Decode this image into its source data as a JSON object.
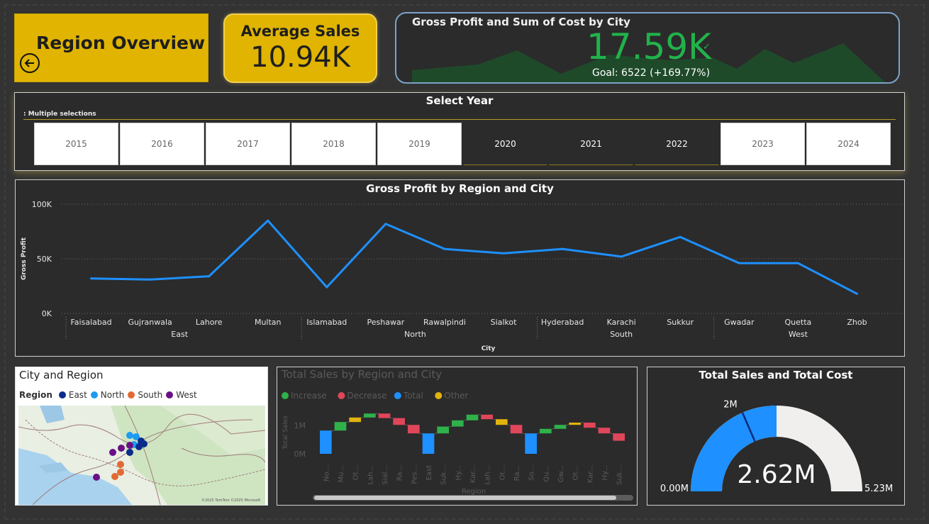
{
  "header": {
    "title": "Region Overview",
    "back_icon": "back-arrow-icon"
  },
  "average_sales": {
    "label": "Average Sales",
    "value": "10.94K"
  },
  "kpi": {
    "label": "Gross Profit and Sum of Cost by City",
    "value": "17.59K",
    "goal": "Goal: 6522 (+169.77%)",
    "trend_color": "#1f5a2e",
    "value_color": "#21b24b"
  },
  "year_slicer": {
    "title": "Select Year",
    "selection_label": ": Multiple selections",
    "years": [
      {
        "label": "2015",
        "selected": false
      },
      {
        "label": "2016",
        "selected": false
      },
      {
        "label": "2017",
        "selected": false
      },
      {
        "label": "2018",
        "selected": false
      },
      {
        "label": "2019",
        "selected": false
      },
      {
        "label": "2020",
        "selected": true
      },
      {
        "label": "2021",
        "selected": true
      },
      {
        "label": "2022",
        "selected": true
      },
      {
        "label": "2023",
        "selected": false
      },
      {
        "label": "2024",
        "selected": false
      }
    ]
  },
  "chart_data": [
    {
      "type": "line",
      "title": "Gross Profit by Region and City",
      "xlabel": "City",
      "ylabel": "Gross Profit",
      "ylim": [
        0,
        100000
      ],
      "yticks": [
        "0K",
        "50K",
        "100K"
      ],
      "grid": true,
      "color": "#1e90ff",
      "categories": [
        "Faisalabad",
        "Gujranwala",
        "Lahore",
        "Multan",
        "Islamabad",
        "Peshawar",
        "Rawalpindi",
        "Sialkot",
        "Hyderabad",
        "Karachi",
        "Sukkur",
        "Gwadar",
        "Quetta",
        "Zhob"
      ],
      "groups": [
        {
          "name": "East",
          "count": 4
        },
        {
          "name": "North",
          "count": 4
        },
        {
          "name": "South",
          "count": 3
        },
        {
          "name": "West",
          "count": 3
        }
      ],
      "values": [
        32000,
        31000,
        34000,
        85000,
        24000,
        82000,
        59000,
        55000,
        59000,
        52000,
        70000,
        46000,
        46000,
        18000
      ]
    },
    {
      "type": "bar",
      "subtype": "waterfall",
      "title": "Total Sales by Region and City",
      "xlabel": "Region",
      "ylabel": "Total Sales",
      "yticks": [
        "0M",
        "1M"
      ],
      "legend": [
        {
          "name": "Increase",
          "color": "#2fb24a"
        },
        {
          "name": "Decrease",
          "color": "#e0465a"
        },
        {
          "name": "Total",
          "color": "#1e90ff"
        },
        {
          "name": "Other",
          "color": "#e2b20e"
        }
      ],
      "categories": [
        "No...",
        "Mu...",
        "Ot...",
        "Lah...",
        "Sial...",
        "Ra...",
        "Pes...",
        "East",
        "Suk...",
        "Hy...",
        "Kar...",
        "Lah...",
        "Ot...",
        "Ra...",
        "So...",
        "Qu...",
        "Gw...",
        "Ot...",
        "Kar...",
        "Hy...",
        "Suk..."
      ],
      "bars": [
        {
          "kind": "Total",
          "from": 0.0,
          "to": 0.82
        },
        {
          "kind": "Increase",
          "from": 0.82,
          "to": 1.12
        },
        {
          "kind": "Other",
          "from": 1.12,
          "to": 1.28
        },
        {
          "kind": "Increase",
          "from": 1.28,
          "to": 1.42
        },
        {
          "kind": "Decrease",
          "from": 1.42,
          "to": 1.26
        },
        {
          "kind": "Decrease",
          "from": 1.26,
          "to": 1.02
        },
        {
          "kind": "Decrease",
          "from": 1.02,
          "to": 0.72
        },
        {
          "kind": "Total",
          "from": 0.0,
          "to": 0.72
        },
        {
          "kind": "Increase",
          "from": 0.72,
          "to": 0.96
        },
        {
          "kind": "Increase",
          "from": 0.96,
          "to": 1.18
        },
        {
          "kind": "Increase",
          "from": 1.18,
          "to": 1.38
        },
        {
          "kind": "Decrease",
          "from": 1.38,
          "to": 1.22
        },
        {
          "kind": "Other",
          "from": 1.22,
          "to": 1.02
        },
        {
          "kind": "Decrease",
          "from": 1.02,
          "to": 0.72
        },
        {
          "kind": "Total",
          "from": 0.0,
          "to": 0.72
        },
        {
          "kind": "Increase",
          "from": 0.72,
          "to": 0.88
        },
        {
          "kind": "Increase",
          "from": 0.88,
          "to": 1.02
        },
        {
          "kind": "Other",
          "from": 1.02,
          "to": 1.1
        },
        {
          "kind": "Decrease",
          "from": 1.1,
          "to": 0.92
        },
        {
          "kind": "Decrease",
          "from": 0.92,
          "to": 0.72
        },
        {
          "kind": "Decrease",
          "from": 0.72,
          "to": 0.46
        }
      ]
    },
    {
      "type": "gauge",
      "title": "Total Sales and Total Cost",
      "value_label": "2.62M",
      "min_label": "0.00M",
      "max_label": "5.23M",
      "target_label": "2M",
      "value_fraction": 0.5,
      "target_fraction": 0.37,
      "fill_color": "#1e90ff",
      "track_color": "#f0efee"
    }
  ],
  "map": {
    "title": "City and Region",
    "legend_title": "Region",
    "legend": [
      {
        "name": "East",
        "color": "#0b2c8c"
      },
      {
        "name": "North",
        "color": "#1e9bf0"
      },
      {
        "name": "South",
        "color": "#e06a32"
      },
      {
        "name": "West",
        "color": "#6a0f86"
      }
    ],
    "credit": "©2025 TomTom ©2025 Microsoft"
  }
}
